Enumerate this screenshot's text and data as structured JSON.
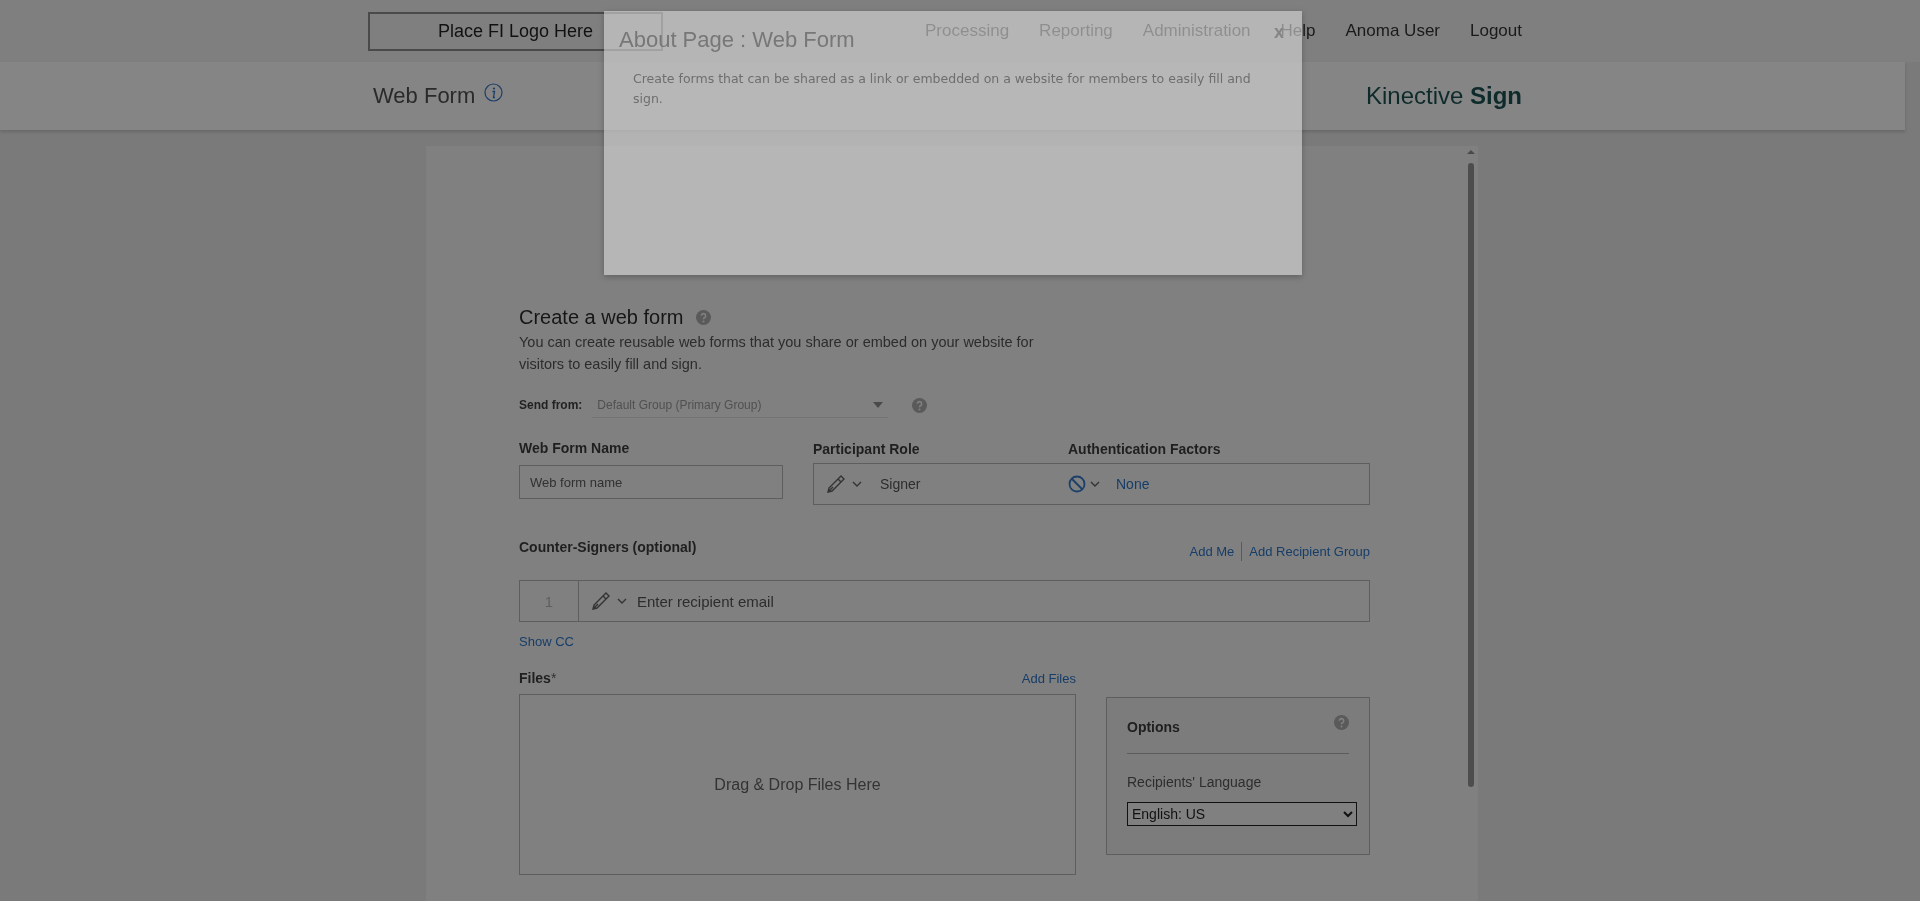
{
  "header": {
    "logo": "Place FI Logo Here",
    "nav": [
      {
        "label": "Processing"
      },
      {
        "label": "Reporting"
      },
      {
        "label": "Administration"
      },
      {
        "label": "Help"
      },
      {
        "label": "Anoma User"
      },
      {
        "label": "Logout"
      }
    ]
  },
  "subheader": {
    "title": "Web Form",
    "brand": "Kinective **Sign**"
  },
  "form": {
    "title": "Create a web form",
    "description": "You can create reusable web forms that you share or embed on your website for visitors to easily fill and sign.",
    "send_from": {
      "label": "Send from:",
      "value": "Default Group (Primary Group)"
    },
    "name_field": {
      "label": "Web Form Name",
      "placeholder": "Web form name"
    },
    "role": {
      "label": "Participant Role",
      "value": "Signer"
    },
    "auth": {
      "label": "Authentication Factors",
      "value": "None"
    },
    "counter_signers": {
      "label": "Counter-Signers (optional)",
      "links": [
        "Add Me",
        "Add Recipient Group"
      ],
      "rows": [
        {
          "number": "1",
          "placeholder": "Enter recipient email"
        }
      ]
    },
    "show_cc": "Show CC",
    "files": {
      "label": "Files",
      "required_mark": "*",
      "link": "Add Files",
      "dropzone": "Drag & Drop Files Here"
    },
    "options": {
      "title": "Options",
      "language_label": "Recipients' Language",
      "language": "English: US"
    }
  },
  "modal": {
    "title": "About Page : Web Form",
    "close": "x",
    "body": "Create forms that can be shared as a link or embedded on a website for members to easily fill and sign."
  }
}
